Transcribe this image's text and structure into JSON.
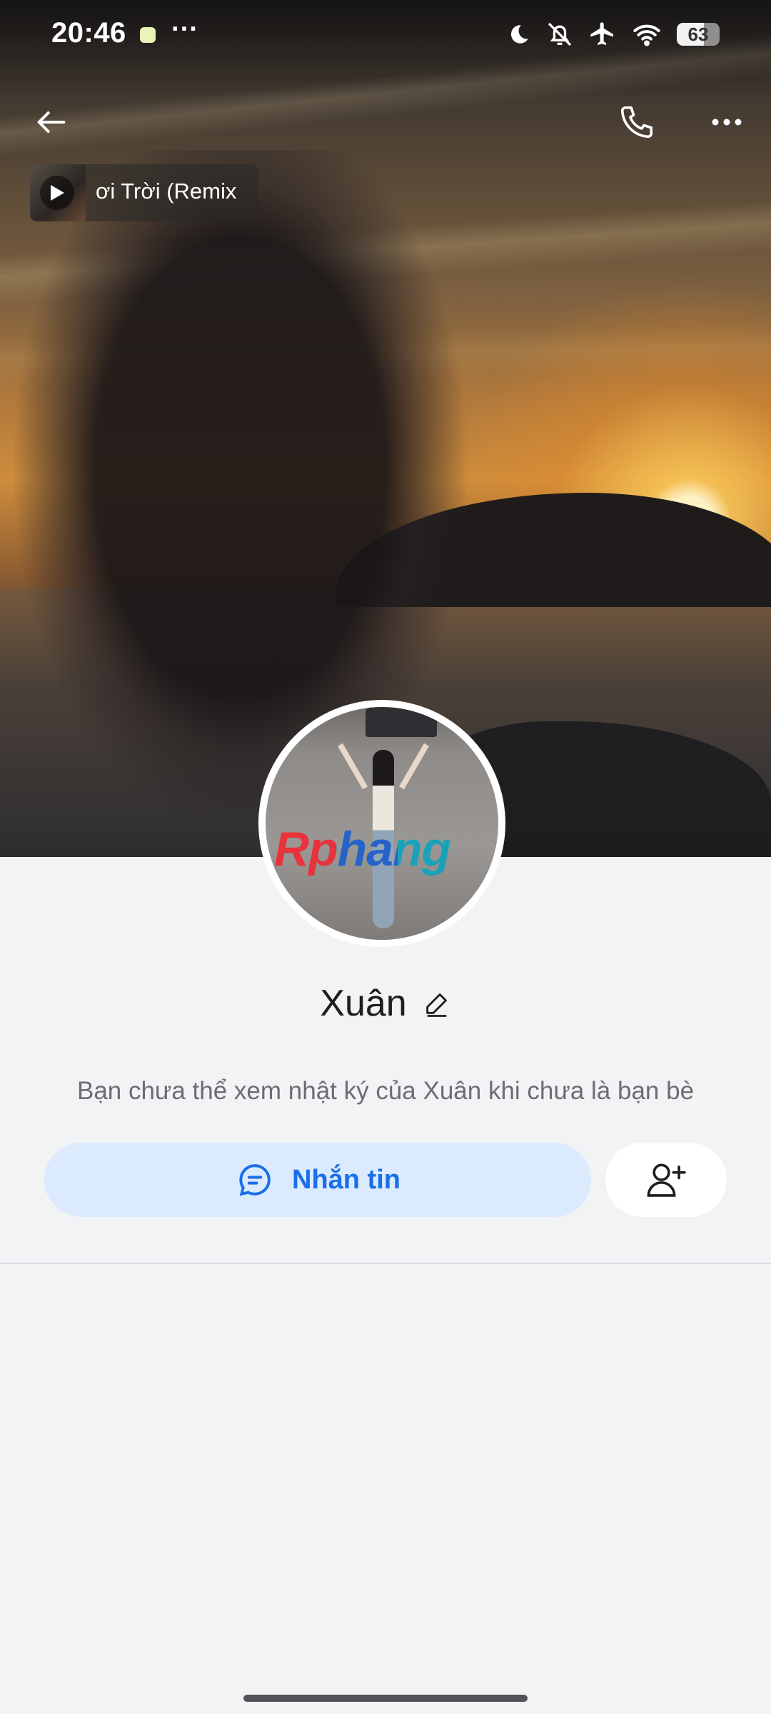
{
  "status_bar": {
    "time": "20:46",
    "overflow_dots": "···",
    "battery_level": "63",
    "icons": [
      "sleep-moon-icon",
      "muted-bell-icon",
      "airplane-icon",
      "wifi-icon",
      "battery-icon"
    ]
  },
  "header": {
    "back_icon": "arrow-left-icon",
    "call_icon": "phone-icon",
    "more_icon": "more-horizontal-icon"
  },
  "music": {
    "title": "ơi Trời (Remix",
    "play_icon": "play-icon"
  },
  "profile": {
    "name": "Xuân",
    "edit_icon": "pencil-icon",
    "avatar_watermark": "Rphang",
    "notice": "Bạn chưa thể xem nhật ký của Xuân khi chưa là bạn bè"
  },
  "actions": {
    "message_label": "Nhắn tin",
    "message_icon": "chat-bubble-icon",
    "add_friend_icon": "add-friend-icon"
  },
  "colors": {
    "accent": "#1a6ee8",
    "message_button_bg": "#dbeafd",
    "page_bg": "#f2f3f5"
  }
}
